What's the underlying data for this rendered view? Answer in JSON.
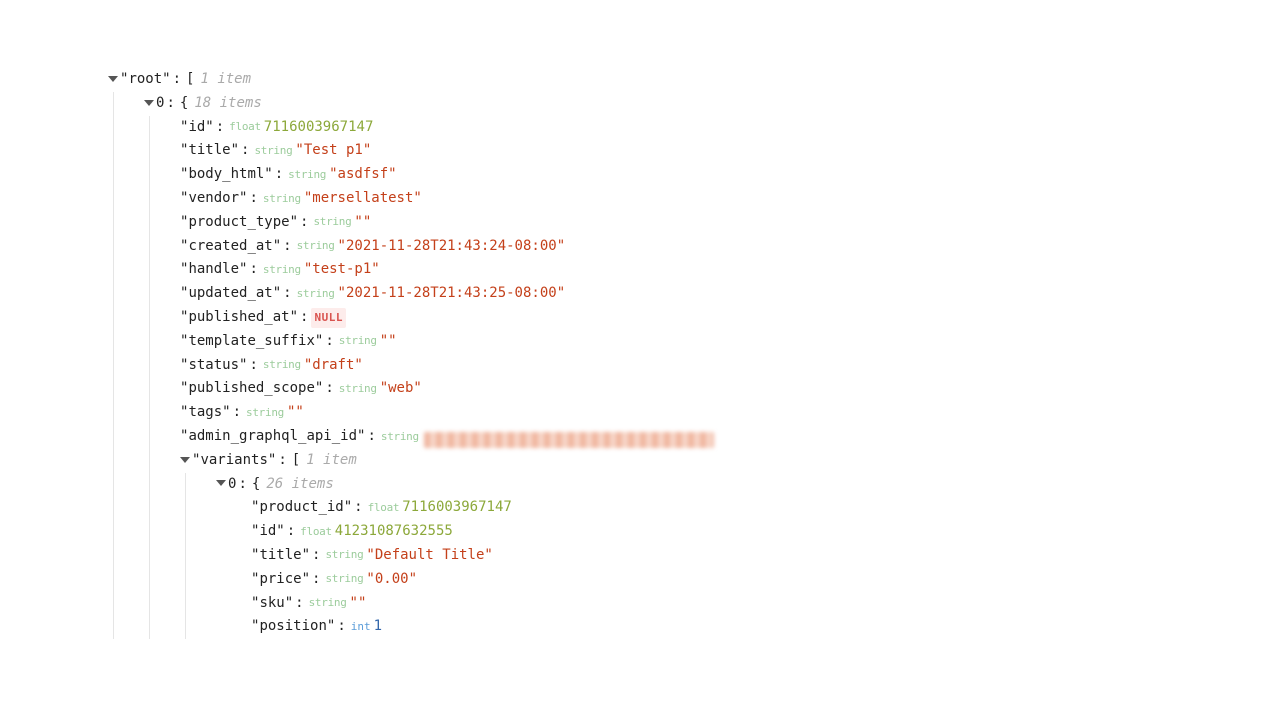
{
  "root": {
    "label": "root",
    "count": "1 item",
    "idx0": {
      "label": "0",
      "count": "18 items"
    }
  },
  "p": {
    "id": {
      "key": "id",
      "type": "float",
      "value": "7116003967147"
    },
    "title": {
      "key": "title",
      "type": "string",
      "value": "Test p1"
    },
    "body_html": {
      "key": "body_html",
      "type": "string",
      "value": "asdfsf"
    },
    "vendor": {
      "key": "vendor",
      "type": "string",
      "value": "mersellatest"
    },
    "product_type": {
      "key": "product_type",
      "type": "string",
      "value": ""
    },
    "created_at": {
      "key": "created_at",
      "type": "string",
      "value": "2021-11-28T21:43:24-08:00"
    },
    "handle": {
      "key": "handle",
      "type": "string",
      "value": "test-p1"
    },
    "updated_at": {
      "key": "updated_at",
      "type": "string",
      "value": "2021-11-28T21:43:25-08:00"
    },
    "published_at": {
      "key": "published_at",
      "null_label": "NULL"
    },
    "template_suffix": {
      "key": "template_suffix",
      "type": "string",
      "value": ""
    },
    "status": {
      "key": "status",
      "type": "string",
      "value": "draft"
    },
    "published_scope": {
      "key": "published_scope",
      "type": "string",
      "value": "web"
    },
    "tags": {
      "key": "tags",
      "type": "string",
      "value": ""
    },
    "admin_graphql_api_id": {
      "key": "admin_graphql_api_id",
      "type": "string"
    }
  },
  "variants": {
    "label": "variants",
    "count": "1 item",
    "idx0": {
      "label": "0",
      "count": "26 items"
    }
  },
  "v": {
    "product_id": {
      "key": "product_id",
      "type": "float",
      "value": "7116003967147"
    },
    "id": {
      "key": "id",
      "type": "float",
      "value": "41231087632555"
    },
    "title": {
      "key": "title",
      "type": "string",
      "value": "Default Title"
    },
    "price": {
      "key": "price",
      "type": "string",
      "value": "0.00"
    },
    "sku": {
      "key": "sku",
      "type": "string",
      "value": ""
    },
    "position": {
      "key": "position",
      "type": "int",
      "value": "1"
    }
  }
}
